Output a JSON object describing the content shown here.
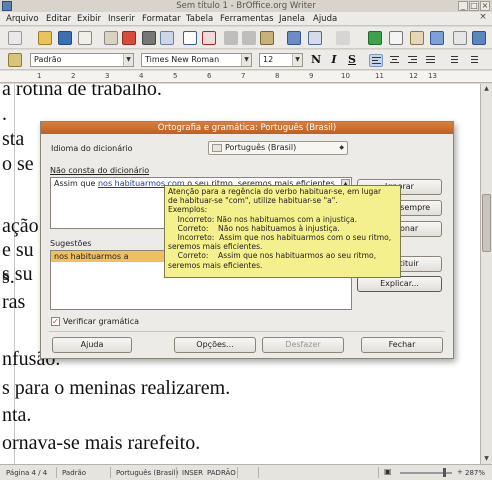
{
  "window": {
    "title": "Sem título 1 - BrOffice.org Writer"
  },
  "menubar": {
    "items": [
      "Arquivo",
      "Editar",
      "Exibir",
      "Inserir",
      "Formatar",
      "Tabela",
      "Ferramentas",
      "Janela",
      "Ajuda"
    ],
    "close": "×"
  },
  "formatting": {
    "style": "Padrão",
    "font": "Times New Roman",
    "size": "12",
    "bold": "N",
    "italic": "I",
    "underline": "S"
  },
  "ruler": {
    "numbers": [
      "1",
      "2",
      "3",
      "4",
      "5",
      "6",
      "7",
      "8",
      "9",
      "10",
      "11",
      "12",
      "13"
    ]
  },
  "document": {
    "lines": [
      "a rotina de trabalho.",
      ".",
      "sta",
      "o se",
      "",
      "ação",
      "e su",
      "s su",
      "s.",
      "ras",
      "",
      "nfusão.",
      "s para o meninas realizarem.",
      "nta.",
      "ornava-se mais rarefeito."
    ]
  },
  "dialog": {
    "title": "Ortografia e gramática: Português (Brasil)",
    "language_label": "Idioma do dicionário",
    "language_value": "Português (Brasil)",
    "not_in_dict_label": "Não consta do dicionário",
    "sentence_before": "Assim que ",
    "sentence_error": "nos habituarmos com",
    "sentence_after": " o seu ritmo, seremos mais eficientes.",
    "suggestions_label": "Sugestões",
    "suggestions": [
      "nos habituarmos a"
    ],
    "check_grammar_label": "Verificar gramática",
    "buttons": {
      "ignore": "Ignorar",
      "ignore_all": "Ignorar sempre",
      "add": "Adicionar",
      "replace": "Substituir",
      "explain": "Explicar...",
      "help": "Ajuda",
      "options": "Opções...",
      "undo": "Desfazer",
      "close": "Fechar"
    },
    "tooltip": "Atenção para a regência do verbo habituar-se, em lugar\nde habituar-se \"com\", utilize habituar-se \"a\".\nExemplos:\n    Incorreto: Não nos habituamos com a injustiça.\n    Correto:    Não nos habituamos à injustiça.\n    Incorreto:  Assim que nos habituarmos com o seu ritmo,\nseremos mais eficientes.\n    Correto:    Assim que nos habituarmos ao seu ritmo,\nseremos mais eficientes."
  },
  "status": {
    "page": "Página 4 / 4",
    "style": "Padrão",
    "language": "Português (Brasil)",
    "insert": "INSER",
    "std": "PADRÃO",
    "zoom": "287%"
  },
  "colors": {
    "dialog_title": "#c86a2a",
    "tooltip_bg": "#f5f08e",
    "selection": "#f0c060",
    "error_text": "#1f3a93"
  }
}
